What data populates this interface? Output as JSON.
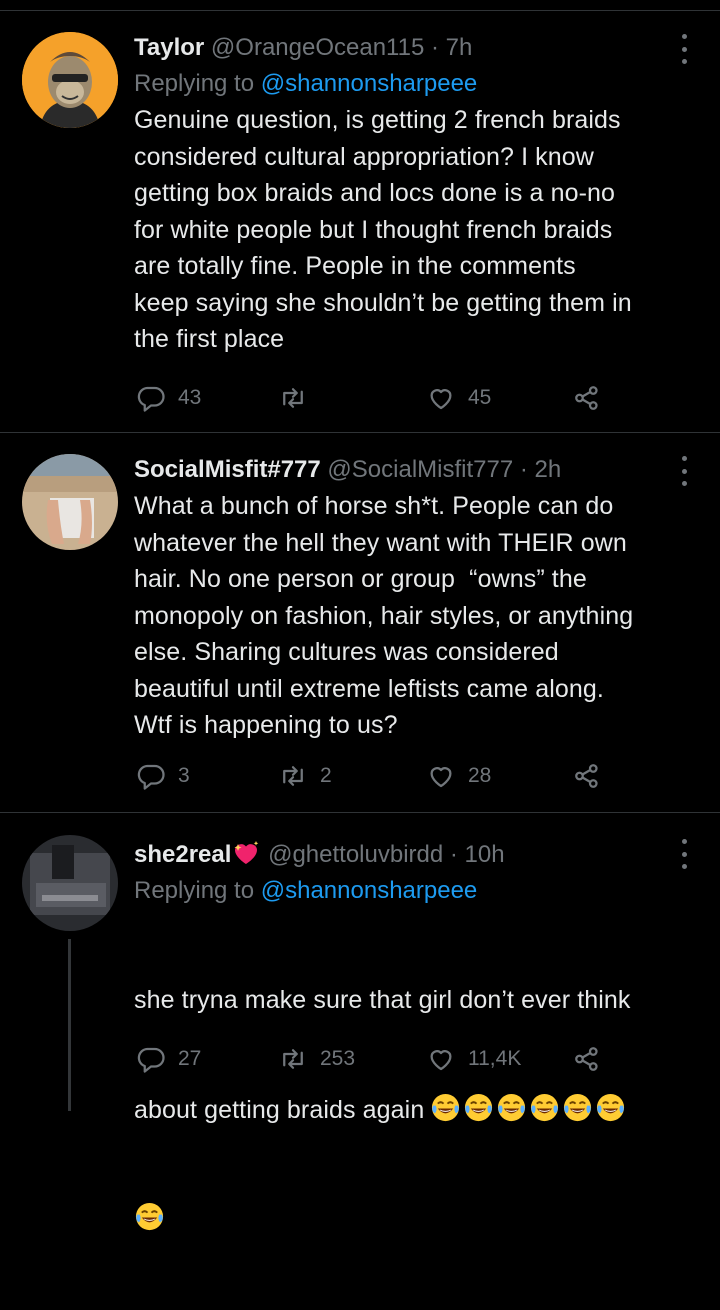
{
  "tweets": [
    {
      "name": "Taylor",
      "handle": "@OrangeOcean115",
      "time": "· 7h",
      "replying_prefix": "Replying to ",
      "replying_to": "@shannonsharpeee",
      "text": "Genuine question, is getting 2 french braids\nconsidered cultural appropriation? I know\ngetting box braids and locs done is a no-no\nfor white people but I thought french braids\nare totally fine. People in the comments\nkeep saying she shouldn’t be getting them in\nthe first place",
      "replies": "43",
      "retweets": "",
      "likes": "45",
      "avatar_icon": "ape-avatar-icon"
    },
    {
      "name": "SocialMisfit#777",
      "handle": "@SocialMisfit777",
      "time": "· 2h",
      "text": "What a bunch of horse sh*t. People can do\nwhatever the hell they want with THEIR own\nhair. No one person or group  “owns” the\nmonopoly on fashion, hair styles, or anything\nelse. Sharing cultures was considered\nbeautiful until extreme leftists came along.\nWtf is happening to us?",
      "replies": "3",
      "retweets": "2",
      "likes": "28",
      "avatar_icon": "feet-photo-avatar-icon"
    },
    {
      "name": "she2real",
      "handle": "@ghettoluvbirdd",
      "time": "· 10h",
      "replying_prefix": "Replying to ",
      "replying_to": "@shannonsharpeee",
      "text_line1": "she tryna make sure that girl don’t ever think",
      "text_line2": "about getting braids again",
      "replies": "27",
      "retweets": "253",
      "likes": "11,4K",
      "avatar_icon": "dark-photo-avatar-icon",
      "emoji": "face-with-tears-of-joy"
    }
  ],
  "colors": {
    "background": "#000000",
    "text": "#e7e9ea",
    "muted": "#71767b",
    "link": "#1d9bf0",
    "divider": "#2f3336"
  }
}
